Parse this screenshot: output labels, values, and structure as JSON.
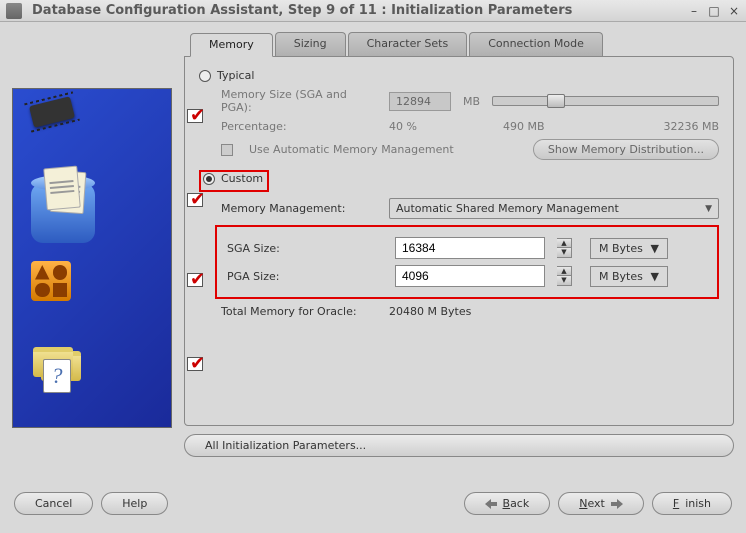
{
  "window": {
    "title": "Database Configuration Assistant, Step 9 of 11 : Initialization Parameters"
  },
  "tabs": {
    "memory": "Memory",
    "sizing": "Sizing",
    "charsets": "Character Sets",
    "connmode": "Connection Mode"
  },
  "typical": {
    "label": "Typical",
    "memsize_label": "Memory Size (SGA and PGA):",
    "memsize_value": "12894",
    "memsize_unit": "MB",
    "percent_label": "Percentage:",
    "percent_value": "40 %",
    "mid_value": "490 MB",
    "max_value": "32236 MB",
    "auto_mem_label": "Use Automatic Memory Management",
    "show_dist_btn": "Show Memory Distribution..."
  },
  "custom": {
    "label": "Custom",
    "mm_label": "Memory Management:",
    "mm_value": "Automatic Shared Memory Management",
    "sga_label": "SGA Size:",
    "sga_value": "16384",
    "sga_unit": "M Bytes",
    "pga_label": "PGA Size:",
    "pga_value": "4096",
    "pga_unit": "M Bytes",
    "total_label": "Total Memory for Oracle:",
    "total_value": "20480 M Bytes"
  },
  "buttons": {
    "all_params": "All Initialization Parameters...",
    "cancel": "Cancel",
    "help": "Help",
    "back": "Back",
    "next": "Next",
    "finish": "Finish"
  }
}
